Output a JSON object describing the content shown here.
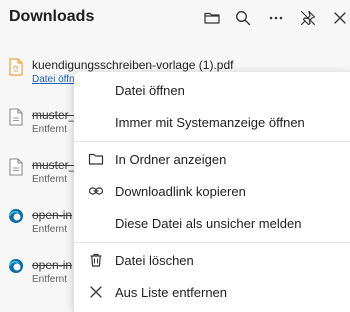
{
  "header": {
    "title": "Downloads"
  },
  "items": [
    {
      "name": "kuendigungsschreiben-vorlage (1).pdf",
      "sub": "Datei öffnen",
      "type": "pdf"
    },
    {
      "name": "muster_",
      "sub": "Entfernt",
      "type": "file"
    },
    {
      "name": "muster_",
      "sub": "Entfernt",
      "type": "file"
    },
    {
      "name": "open-in",
      "sub": "Entfernt",
      "type": "edge"
    },
    {
      "name": "open-in",
      "sub": "Entfernt",
      "type": "edge"
    }
  ],
  "menu": {
    "open_file": "Datei öffnen",
    "open_system": "Immer mit Systemanzeige öffnen",
    "show_in_folder": "In Ordner anzeigen",
    "copy_link": "Downloadlink kopieren",
    "report_unsafe": "Diese Datei als unsicher melden",
    "delete_file": "Datei löschen",
    "remove_from_list": "Aus Liste entfernen"
  },
  "colors": {
    "link": "#1a5fb4",
    "pdf_icon": "#e8a33d",
    "edge_icon": "#0b6aa8"
  }
}
